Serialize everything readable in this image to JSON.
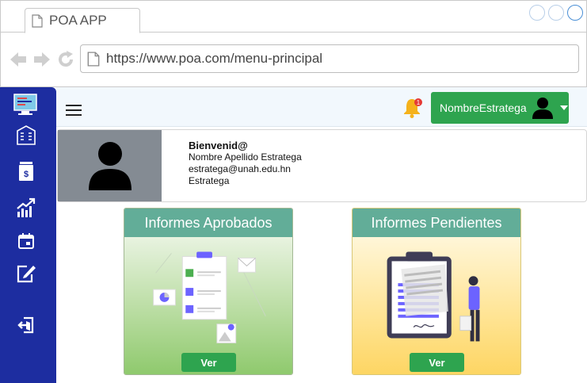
{
  "browser": {
    "tab_title": "POA APP",
    "url": "https://www.poa.com/menu-principal",
    "nav_icons": [
      "back-arrow-icon",
      "forward-arrow-icon",
      "reload-icon"
    ]
  },
  "sidebar": {
    "items": [
      {
        "icon": "dashboard-icon"
      },
      {
        "icon": "building-icon"
      },
      {
        "icon": "money-document-icon"
      },
      {
        "icon": "chart-growth-icon"
      },
      {
        "icon": "calendar-icon"
      },
      {
        "icon": "edit-document-icon"
      },
      {
        "icon": "logout-icon"
      }
    ]
  },
  "topbar": {
    "notification_count": "1",
    "user_name": "NombreEstratega"
  },
  "profile": {
    "welcome": "Bienvenid@",
    "full_name": "Nombre Apellido Estratega",
    "email": "estratega@unah.edu.hn",
    "role": "Estratega"
  },
  "cards": [
    {
      "title": "Informes Aprobados",
      "button": "Ver"
    },
    {
      "title": "Informes Pendientes",
      "button": "Ver"
    }
  ],
  "colors": {
    "sidebar": "#1d2da0",
    "accent_green": "#2ea44f",
    "card_header": "#62ad98",
    "bell": "#f5b21b"
  }
}
